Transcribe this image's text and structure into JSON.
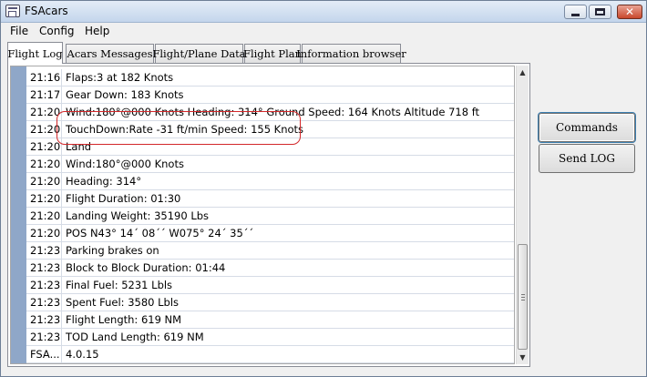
{
  "window": {
    "title": "FSAcars"
  },
  "menu": [
    "File",
    "Config",
    "Help"
  ],
  "tabs": [
    "Flight Log",
    "Acars Messages",
    "Flight/Plane Data",
    "Flight Plan",
    "Information browser"
  ],
  "active_tab": "Flight Log",
  "log": [
    {
      "time": "21:16",
      "msg": "Flaps:3 at 182 Knots"
    },
    {
      "time": "21:17",
      "msg": "Gear Down: 183 Knots"
    },
    {
      "time": "21:20",
      "msg": "Wind:180°@000 Knots Heading: 314° Ground Speed: 164 Knots Altitude 718 ft"
    },
    {
      "time": "21:20",
      "msg": "TouchDown:Rate -31 ft/min Speed: 155 Knots"
    },
    {
      "time": "21:20",
      "msg": "Land"
    },
    {
      "time": "21:20",
      "msg": "Wind:180°@000 Knots"
    },
    {
      "time": "21:20",
      "msg": "Heading: 314°"
    },
    {
      "time": "21:20",
      "msg": "Flight Duration: 01:30"
    },
    {
      "time": "21:20",
      "msg": "Landing Weight: 35190 Lbs"
    },
    {
      "time": "21:20",
      "msg": "POS N43° 14´ 08´´ W075° 24´ 35´´"
    },
    {
      "time": "21:23",
      "msg": "Parking brakes on"
    },
    {
      "time": "21:23",
      "msg": "Block to Block Duration: 01:44"
    },
    {
      "time": "21:23",
      "msg": "Final Fuel: 5231 Lbls"
    },
    {
      "time": "21:23",
      "msg": "Spent Fuel: 3580 Lbls"
    },
    {
      "time": "21:23",
      "msg": "Flight Length: 619 NM"
    },
    {
      "time": "21:23",
      "msg": "TOD Land Length: 619 NM"
    },
    {
      "time": "FSA...",
      "msg": "4.0.15"
    }
  ],
  "buttons": {
    "commands": "Commands",
    "send_log": "Send LOG"
  },
  "icons": {
    "app": "fsacars-app-icon",
    "minimize": "minimize-icon",
    "maximize": "maximize-icon",
    "close": "close-icon",
    "scroll_up": "scroll-up-arrow-icon",
    "scroll_down": "scroll-down-arrow-icon"
  },
  "colors": {
    "annotation": "#d3282a",
    "gutter": "#8fa7c8"
  }
}
